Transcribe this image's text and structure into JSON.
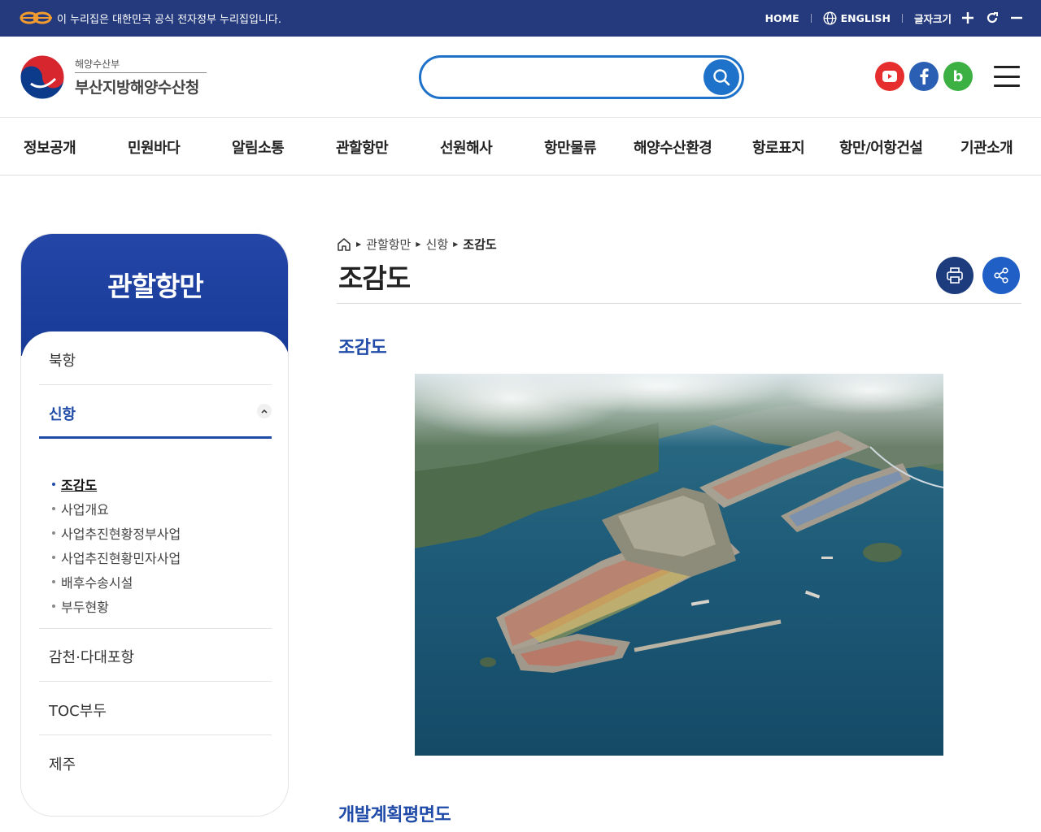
{
  "gov_banner": {
    "text": "이 누리집은 대한민국 공식 전자정부 누리집입니다.",
    "home": "HOME",
    "english": "ENGLISH",
    "font_size": "글자크기"
  },
  "header": {
    "logo_sub": "해양수산부",
    "logo_main": "부산지방해양수산청",
    "search_placeholder": "",
    "sns": [
      {
        "icon": "youtube-icon",
        "color": "#e62e2e"
      },
      {
        "icon": "facebook-icon",
        "color": "#2b5fb3"
      },
      {
        "icon": "blog-icon",
        "color": "#3cb043",
        "label": "b"
      }
    ]
  },
  "gnb": [
    "정보공개",
    "민원바다",
    "알림소통",
    "관할항만",
    "선원해사",
    "항만물류",
    "해양수산환경",
    "항로표지",
    "항만/어항건설",
    "기관소개"
  ],
  "snb": {
    "title": "관할항만",
    "items": [
      "북항",
      "신항",
      "감천·다대포항",
      "TOC부두",
      "제주"
    ],
    "sub_items": [
      "조감도",
      "사업개요",
      "사업추진현황정부사업",
      "사업추진현황민자사업",
      "배후수송시설",
      "부두현황"
    ]
  },
  "breadcrumb": [
    "관할항만",
    "신항",
    "조감도"
  ],
  "page_title": "조감도",
  "sections": {
    "first": "조감도",
    "second": "개발계획평면도"
  },
  "colors": {
    "gov_bar": "#243a7c",
    "accent": "#1f4aa8",
    "search_border": "#1f72c9",
    "print_button": "#1d3c7e",
    "share_button": "#1f5fc6"
  }
}
